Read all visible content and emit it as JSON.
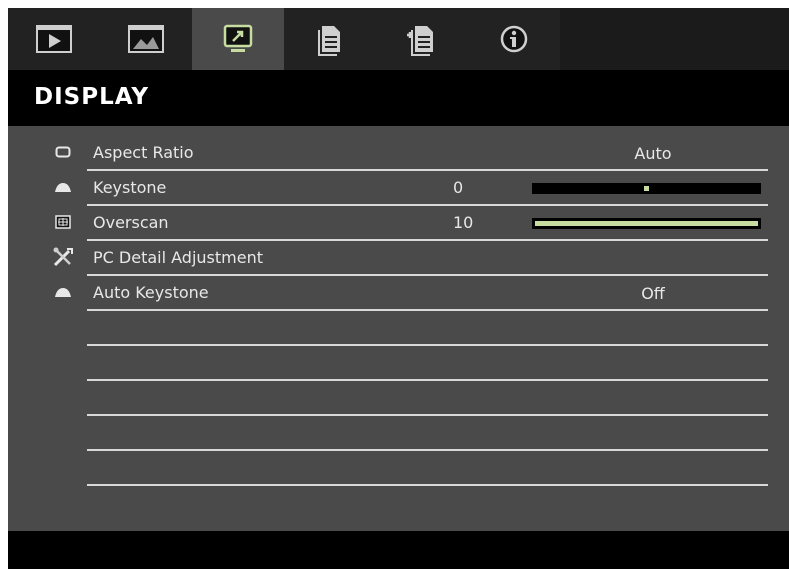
{
  "tabs": [
    {
      "icon": "play-screen-icon",
      "active": false
    },
    {
      "icon": "picture-image-icon",
      "active": false
    },
    {
      "icon": "display-monitor-icon",
      "active": true
    },
    {
      "icon": "settings-document-icon",
      "active": false
    },
    {
      "icon": "advanced-document-icon",
      "active": false
    },
    {
      "icon": "info-icon",
      "active": false
    }
  ],
  "page_title": "DISPLAY",
  "menu": {
    "aspect_ratio": {
      "label": "Aspect Ratio",
      "value": "Auto",
      "icon": "aspect-ratio-icon"
    },
    "keystone": {
      "label": "Keystone",
      "number": "0",
      "icon": "keystone-icon",
      "level_fraction": 0.5
    },
    "overscan": {
      "label": "Overscan",
      "number": "10",
      "icon": "overscan-icon",
      "level_fraction": 1.0
    },
    "pc_detail": {
      "label": "PC Detail Adjustment",
      "icon": "tools-icon"
    },
    "auto_keystone": {
      "label": "Auto Keystone",
      "value": "Off",
      "icon": "auto-keystone-icon"
    }
  },
  "colors": {
    "accent": "#c6dca0",
    "panel": "#4a4a4a",
    "header": "#000000"
  }
}
